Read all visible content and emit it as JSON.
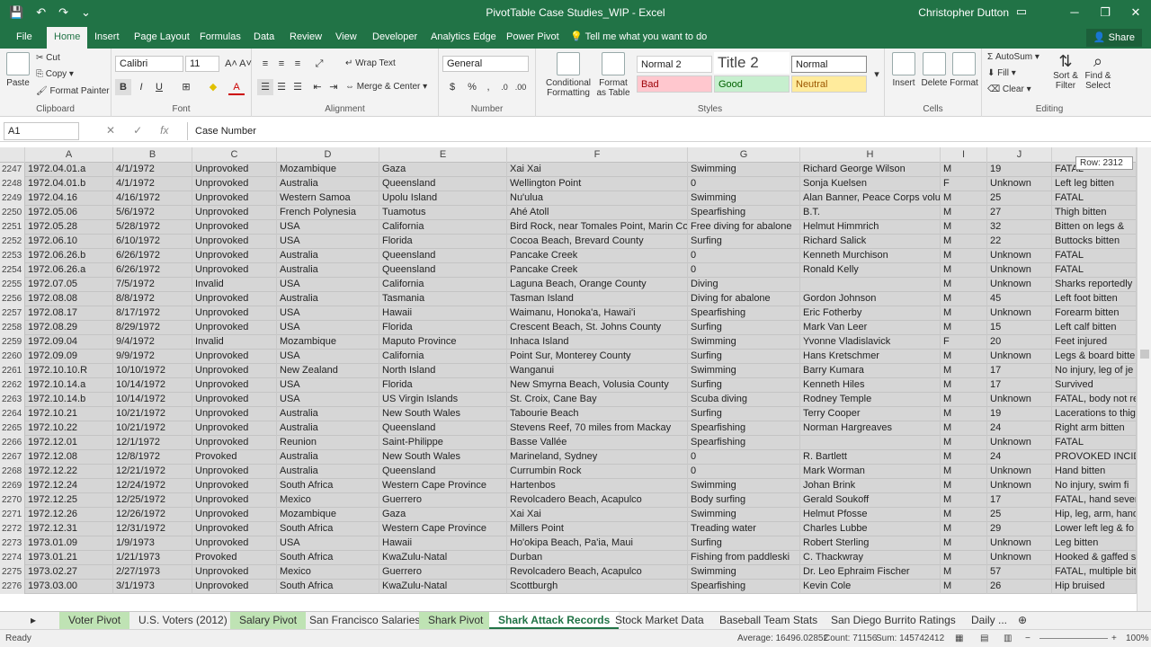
{
  "window": {
    "title": "PivotTable Case Studies_WIP - Excel",
    "user": "Christopher Dutton"
  },
  "tabs": [
    "File",
    "Home",
    "Insert",
    "Page Layout",
    "Formulas",
    "Data",
    "Review",
    "View",
    "Developer",
    "Analytics Edge",
    "Power Pivot"
  ],
  "tell_me": "Tell me what you want to do",
  "share": "Share",
  "ribbon": {
    "clipboard": {
      "paste": "Paste",
      "cut": "Cut",
      "copy": "Copy",
      "format_painter": "Format Painter",
      "label": "Clipboard"
    },
    "font": {
      "name": "Calibri",
      "size": "11",
      "label": "Font"
    },
    "alignment": {
      "wrap": "Wrap Text",
      "merge": "Merge & Center",
      "label": "Alignment"
    },
    "number": {
      "format": "General",
      "label": "Number"
    },
    "styles": {
      "conditional": "Conditional Formatting",
      "format_as_table": "Format as Table",
      "normal2": "Normal 2",
      "title2": "Title 2",
      "normal": "Normal",
      "bad": "Bad",
      "good": "Good",
      "neutral": "Neutral",
      "label": "Styles"
    },
    "cells": {
      "insert": "Insert",
      "delete": "Delete",
      "format": "Format",
      "label": "Cells"
    },
    "editing": {
      "autosum": "AutoSum",
      "fill": "Fill",
      "clear": "Clear",
      "sort": "Sort & Filter",
      "find": "Find & Select",
      "label": "Editing"
    }
  },
  "formula_bar": {
    "name_box": "A1",
    "formula": "Case Number"
  },
  "columns": [
    "A",
    "B",
    "C",
    "D",
    "E",
    "F",
    "G",
    "H",
    "I",
    "J"
  ],
  "tooltip": "Row: 2312",
  "rows": [
    [
      "2247",
      "1972.04.01.a",
      "4/1/1972",
      "Unprovoked",
      "Mozambique",
      "Gaza",
      "Xai Xai",
      "Swimming",
      "Richard  George Wilson",
      "M",
      "19",
      "FATAL"
    ],
    [
      "2248",
      "1972.04.01.b",
      "4/1/1972",
      "Unprovoked",
      "Australia",
      "Queensland",
      "Wellington Point",
      "0",
      "Sonja Kuelsen",
      "F",
      "Unknown",
      "Left leg bitten"
    ],
    [
      "2249",
      "1972.04.16",
      "4/16/1972",
      "Unprovoked",
      "Western Samoa",
      "Upolu Island",
      "Nu'ulua",
      "Swimming",
      "Alan Banner,  Peace Corps volu",
      "M",
      "25",
      "FATAL"
    ],
    [
      "2250",
      "1972.05.06",
      "5/6/1972",
      "Unprovoked",
      "French Polynesia",
      "Tuamotus",
      "Ahé Atoll",
      "Spearfishing",
      "B.T.",
      "M",
      "27",
      "Thigh bitten"
    ],
    [
      "2251",
      "1972.05.28",
      "5/28/1972",
      "Unprovoked",
      "USA",
      "California",
      "Bird Rock, near Tomales Point, Marin Co",
      "Free diving for abalone",
      "Helmut Himmrich",
      "M",
      "32",
      "Bitten on legs &"
    ],
    [
      "2252",
      "1972.06.10",
      "6/10/1972",
      "Unprovoked",
      "USA",
      "Florida",
      "Cocoa Beach, Brevard County",
      "Surfing",
      "Richard Salick",
      "M",
      "22",
      "Buttocks bitten"
    ],
    [
      "2253",
      "1972.06.26.b",
      "6/26/1972",
      "Unprovoked",
      "Australia",
      "Queensland",
      "Pancake Creek",
      "0",
      "Kenneth Murchison",
      "M",
      "Unknown",
      "FATAL"
    ],
    [
      "2254",
      "1972.06.26.a",
      "6/26/1972",
      "Unprovoked",
      "Australia",
      "Queensland",
      "Pancake Creek",
      "0",
      "Ronald Kelly",
      "M",
      "Unknown",
      "FATAL"
    ],
    [
      "2255",
      "1972.07.05",
      "7/5/1972",
      "Invalid",
      "USA",
      "California",
      "Laguna Beach, Orange County",
      "Diving",
      "",
      "M",
      "Unknown",
      "Sharks reportedly"
    ],
    [
      "2256",
      "1972.08.08",
      "8/8/1972",
      "Unprovoked",
      "Australia",
      "Tasmania",
      "Tasman Island",
      "Diving for abalone",
      "Gordon Johnson",
      "M",
      "45",
      "Left foot bitten"
    ],
    [
      "2257",
      "1972.08.17",
      "8/17/1972",
      "Unprovoked",
      "USA",
      "Hawaii",
      "Waimanu, Honoka'a, Hawai'i",
      "Spearfishing",
      "Eric Fotherby",
      "M",
      "Unknown",
      "Forearm bitten"
    ],
    [
      "2258",
      "1972.08.29",
      "8/29/1972",
      "Unprovoked",
      "USA",
      "Florida",
      "Crescent Beach, St. Johns County",
      "Surfing",
      "Mark Van Leer",
      "M",
      "15",
      "Left calf bitten"
    ],
    [
      "2259",
      "1972.09.04",
      "9/4/1972",
      "Invalid",
      "Mozambique",
      "Maputo Province",
      "Inhaca Island",
      "Swimming",
      "Yvonne Vladislavick",
      "F",
      "20",
      "Feet injured"
    ],
    [
      "2260",
      "1972.09.09",
      "9/9/1972",
      "Unprovoked",
      "USA",
      "California",
      "Point Sur, Monterey County",
      "Surfing",
      "Hans Kretschmer",
      "M",
      "Unknown",
      "Legs & board bitte"
    ],
    [
      "2261",
      "1972.10.10.R",
      "10/10/1972",
      "Unprovoked",
      "New Zealand",
      "North Island",
      "Wanganui",
      "Swimming",
      "Barry Kumara",
      "M",
      "17",
      "No injury, leg of je"
    ],
    [
      "2262",
      "1972.10.14.a",
      "10/14/1972",
      "Unprovoked",
      "USA",
      "Florida",
      "New Smyrna Beach, Volusia County",
      "Surfing",
      "Kenneth Hiles",
      "M",
      "17",
      "Survived"
    ],
    [
      "2263",
      "1972.10.14.b",
      "10/14/1972",
      "Unprovoked",
      "USA",
      "US Virgin Islands",
      "St. Croix, Cane Bay",
      "Scuba diving",
      "Rodney Temple",
      "M",
      "Unknown",
      "FATAL, body not re"
    ],
    [
      "2264",
      "1972.10.21",
      "10/21/1972",
      "Unprovoked",
      "Australia",
      "New South Wales",
      "Tabourie Beach",
      "Surfing",
      "Terry Cooper",
      "M",
      "19",
      "Lacerations to thig"
    ],
    [
      "2265",
      "1972.10.22",
      "10/21/1972",
      "Unprovoked",
      "Australia",
      "Queensland",
      "Stevens Reef, 70 miles from Mackay",
      "Spearfishing",
      "Norman Hargreaves",
      "M",
      "24",
      "Right arm bitten"
    ],
    [
      "2266",
      "1972.12.01",
      "12/1/1972",
      "Unprovoked",
      "Reunion",
      "Saint-Philippe",
      "Basse Vallée",
      "Spearfishing",
      "",
      "M",
      "Unknown",
      "FATAL"
    ],
    [
      "2267",
      "1972.12.08",
      "12/8/1972",
      "Provoked",
      "Australia",
      "New South Wales",
      "Marineland, Sydney",
      "0",
      "R. Bartlett",
      "M",
      "24",
      "PROVOKED INCIDE"
    ],
    [
      "2268",
      "1972.12.22",
      "12/21/1972",
      "Unprovoked",
      "Australia",
      "Queensland",
      "Currumbin Rock",
      "0",
      "Mark Worman",
      "M",
      "Unknown",
      "Hand bitten"
    ],
    [
      "2269",
      "1972.12.24",
      "12/24/1972",
      "Unprovoked",
      "South Africa",
      "Western Cape Province",
      "Hartenbos",
      "Swimming",
      "Johan Brink",
      "M",
      "Unknown",
      "No injury, swim fi"
    ],
    [
      "2270",
      "1972.12.25",
      "12/25/1972",
      "Unprovoked",
      "Mexico",
      "Guerrero",
      "Revolcadero Beach, Acapulco",
      "Body surfing",
      "Gerald Soukoff",
      "M",
      "17",
      "FATAL, hand sever"
    ],
    [
      "2271",
      "1972.12.26",
      "12/26/1972",
      "Unprovoked",
      "Mozambique",
      "Gaza",
      "Xai Xai",
      "Swimming",
      "Helmut Pfosse",
      "M",
      "25",
      "Hip, leg, arm, hand"
    ],
    [
      "2272",
      "1972.12.31",
      "12/31/1972",
      "Unprovoked",
      "South Africa",
      "Western Cape Province",
      "Millers Point",
      "Treading water",
      "Charles Lubbe",
      "M",
      "29",
      "Lower left leg & fo"
    ],
    [
      "2273",
      "1973.01.09",
      "1/9/1973",
      "Unprovoked",
      "USA",
      "Hawaii",
      "Ho'okipa Beach, Pa'ia, Maui",
      "Surfing",
      "Robert Sterling",
      "M",
      "Unknown",
      "Leg bitten"
    ],
    [
      "2274",
      "1973.01.21",
      "1/21/1973",
      "Provoked",
      "South Africa",
      "KwaZulu-Natal",
      "Durban",
      "Fishing from paddleski",
      "C. Thackwray",
      "M",
      "Unknown",
      "Hooked & gaffed s"
    ],
    [
      "2275",
      "1973.02.27",
      "2/27/1973",
      "Unprovoked",
      "Mexico",
      "Guerrero",
      "Revolcadero Beach, Acapulco",
      "Swimming",
      "Dr. Leo Ephraim Fischer",
      "M",
      "57",
      "FATAL, multiple bit"
    ],
    [
      "2276",
      "1973.03.00",
      "3/1/1973",
      "Unprovoked",
      "South Africa",
      "KwaZulu-Natal",
      "Scottburgh",
      "Spearfishing",
      "Kevin Cole",
      "M",
      "26",
      "Hip bruised"
    ]
  ],
  "sheet_tabs": [
    {
      "label": "Voter Pivot",
      "style": "green"
    },
    {
      "label": "U.S. Voters (2012)",
      "style": ""
    },
    {
      "label": "Salary Pivot",
      "style": "green"
    },
    {
      "label": "San Francisco Salaries",
      "style": ""
    },
    {
      "label": "Shark Pivot",
      "style": "green"
    },
    {
      "label": "Shark Attack Records",
      "style": "active"
    },
    {
      "label": "Stock Market Data",
      "style": ""
    },
    {
      "label": "Baseball Team Stats",
      "style": ""
    },
    {
      "label": "San Diego Burrito Ratings",
      "style": ""
    },
    {
      "label": "Daily ...",
      "style": ""
    }
  ],
  "status": {
    "ready": "Ready",
    "average": "Average: 16496.02852",
    "count": "Count: 71156",
    "sum": "Sum: 145742412",
    "zoom": "100%"
  },
  "colors": {
    "accent": "#217346"
  }
}
